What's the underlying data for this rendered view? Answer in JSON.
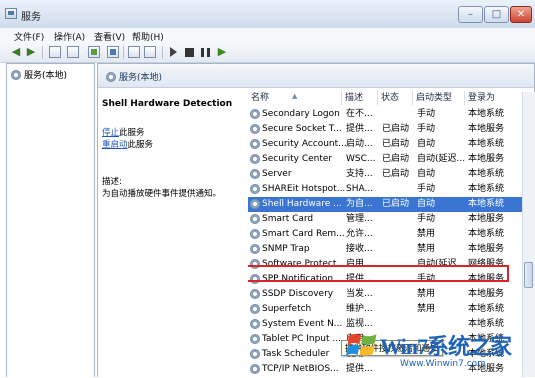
{
  "window": {
    "title": "服务"
  },
  "menu": [
    "文件(F)",
    "操作(A)",
    "查看(V)",
    "帮助(H)"
  ],
  "tree": {
    "root_label": "服务(本地)"
  },
  "panel": {
    "header": "服务(本地)"
  },
  "description": {
    "service_name": "Shell Hardware Detection",
    "stop_link": "停止",
    "stop_suffix": "此服务",
    "restart_link": "重启动",
    "restart_suffix": "此服务",
    "label": "描述:",
    "text": "为自动播放硬件事件提供通知。"
  },
  "table": {
    "columns": [
      "名称",
      "描述",
      "状态",
      "启动类型",
      "登录为"
    ],
    "rows": [
      {
        "name": "Secondary Logon",
        "desc": "在不...",
        "status": "",
        "start": "手动",
        "logon": "本地系统"
      },
      {
        "name": "Secure Socket T...",
        "desc": "提供...",
        "status": "已启动",
        "start": "手动",
        "logon": "本地服务"
      },
      {
        "name": "Security Account...",
        "desc": "启动...",
        "status": "已启动",
        "start": "自动",
        "logon": "本地系统"
      },
      {
        "name": "Security Center",
        "desc": "WSC...",
        "status": "已启动",
        "start": "自动(延迟...",
        "logon": "本地服务"
      },
      {
        "name": "Server",
        "desc": "支持...",
        "status": "已启动",
        "start": "自动",
        "logon": "本地系统"
      },
      {
        "name": "SHAREit Hotspot...",
        "desc": "SHA...",
        "status": "",
        "start": "手动",
        "logon": "本地系统"
      },
      {
        "name": "Shell Hardware ...",
        "desc": "为自...",
        "status": "已启动",
        "start": "自动",
        "logon": "本地系统",
        "selected": true
      },
      {
        "name": "Smart Card",
        "desc": "管理...",
        "status": "",
        "start": "手动",
        "logon": "本地服务"
      },
      {
        "name": "Smart Card Rem...",
        "desc": "允许...",
        "status": "",
        "start": "禁用",
        "logon": "本地系统"
      },
      {
        "name": "SNMP Trap",
        "desc": "接收...",
        "status": "",
        "start": "禁用",
        "logon": "本地服务"
      },
      {
        "name": "Software Protect...",
        "desc": "启用 ...",
        "status": "",
        "start": "自动(延迟...",
        "logon": "网络服务"
      },
      {
        "name": "SPP Notification ...",
        "desc": "提供...",
        "status": "",
        "start": "手动",
        "logon": "本地服务"
      },
      {
        "name": "SSDP Discovery",
        "desc": "当发...",
        "status": "",
        "start": "禁用",
        "logon": "本地服务"
      },
      {
        "name": "Superfetch",
        "desc": "维护...",
        "status": "",
        "start": "禁用",
        "logon": "本地系统"
      },
      {
        "name": "System Event N...",
        "desc": "监视...",
        "status": "",
        "start": "",
        "logon": "本地系统"
      },
      {
        "name": "Tablet PC Input ...",
        "desc": "启用...",
        "status": "",
        "start": "",
        "logon": "本地系统"
      },
      {
        "name": "Task Scheduler",
        "desc": "使用...",
        "status": "",
        "start": "",
        "logon": "本地系统"
      },
      {
        "name": "TCP/IP NetBIOS...",
        "desc": "提供...",
        "status": "",
        "start": "",
        "logon": "本地服务"
      }
    ]
  },
  "tooltip": "提供软件授权激活和通知",
  "watermark": {
    "brand": "Win7系统之家",
    "url": "Www.Winwin7.com"
  },
  "colors": {
    "selection": "#3a76d1",
    "highlight_outline": "#d6252b",
    "link": "#1f56b8"
  },
  "icons": [
    "back-arrow-icon",
    "forward-arrow-icon",
    "console-tree-icon",
    "properties-icon",
    "refresh-icon",
    "export-icon",
    "help-icon",
    "play-icon",
    "stop-icon",
    "pause-icon",
    "resume-icon",
    "gear-icon"
  ]
}
